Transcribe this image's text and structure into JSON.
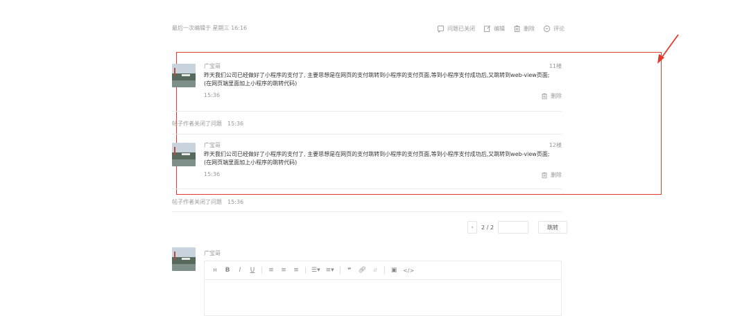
{
  "meta": {
    "last_edited": "最后一次编辑于  星期三 16:16"
  },
  "toolbar": {
    "closed_label": "问题已关闭",
    "edit_label": "编辑",
    "delete_label": "删除",
    "comment_label": "评论"
  },
  "replies": [
    {
      "author": "广宝哥",
      "floor": "11楼",
      "text": "昨天我们公司已经做好了小程序的支付了, 主要思想是在网页的支付跳转到小程序的支付页面,等到小程序支付成功后,又跳转到web-view页面; (在网页端里面加上小程序的跳转代码)",
      "time": "15:36",
      "delete_label": "删除"
    },
    {
      "author": "广宝哥",
      "floor": "12楼",
      "text": "昨天我们公司已经做好了小程序的支付了, 主要思想是在网页的支付跳转到小程序的支付页面,等到小程序支付成功后,又跳转到web-view页面; (在网页端里面加上小程序的跳转代码)",
      "time": "15:36",
      "delete_label": "删除"
    }
  ],
  "system_events": [
    {
      "text": "帖子作者关闭了问题",
      "time": "15:36"
    },
    {
      "text": "帖子作者关闭了问题",
      "time": "15:36"
    }
  ],
  "pagination": {
    "prev_icon": "‹",
    "current": "2 / 2",
    "jump_label": "跳转"
  },
  "compose": {
    "author": "广宝哥",
    "toolbar_items": [
      "H",
      "B",
      "I",
      "U",
      "align-left",
      "align-center",
      "align-right",
      "list-bullet",
      "list-number",
      "quote",
      "link",
      "unlink",
      "image",
      "code"
    ]
  },
  "colors": {
    "annotation": "#e3392c",
    "text_muted": "#999999",
    "border": "#ececec"
  }
}
